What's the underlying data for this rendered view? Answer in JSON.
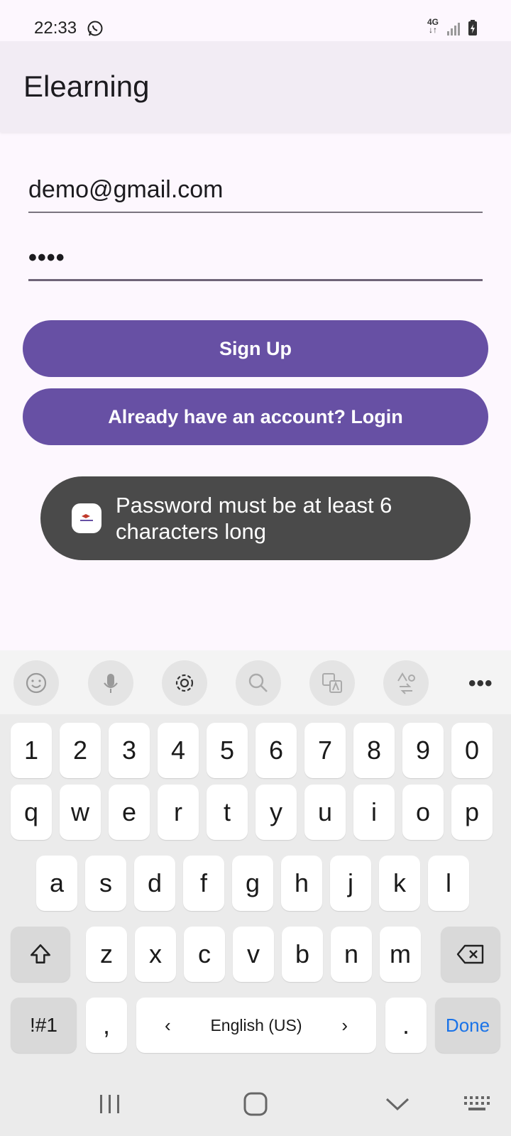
{
  "status_bar": {
    "time": "22:33",
    "network_top": "4G",
    "network_bottom": "↓↑"
  },
  "app_bar": {
    "title": "Elearning"
  },
  "form": {
    "email_value": "demo@gmail.com",
    "password_masked": "••••",
    "signup_label": "Sign Up",
    "login_label": "Already have an account? Login",
    "accent_color": "#6750a4"
  },
  "toast": {
    "message": "Password must be at least 6 characters long"
  },
  "keyboard": {
    "toolbar_icons": [
      "emoji-icon",
      "microphone-icon",
      "settings-icon",
      "search-icon",
      "translate-icon",
      "convert-icon",
      "more-icon"
    ],
    "row_numbers": [
      "1",
      "2",
      "3",
      "4",
      "5",
      "6",
      "7",
      "8",
      "9",
      "0"
    ],
    "row_top": [
      "q",
      "w",
      "e",
      "r",
      "t",
      "y",
      "u",
      "i",
      "o",
      "p"
    ],
    "row_home": [
      "a",
      "s",
      "d",
      "f",
      "g",
      "h",
      "j",
      "k",
      "l"
    ],
    "row_bottom": [
      "z",
      "x",
      "c",
      "v",
      "b",
      "n",
      "m"
    ],
    "symbols_label": "!#1",
    "comma_label": ",",
    "space_label": "English (US)",
    "space_left": "‹",
    "space_right": "›",
    "period_label": ".",
    "done_label": "Done"
  }
}
